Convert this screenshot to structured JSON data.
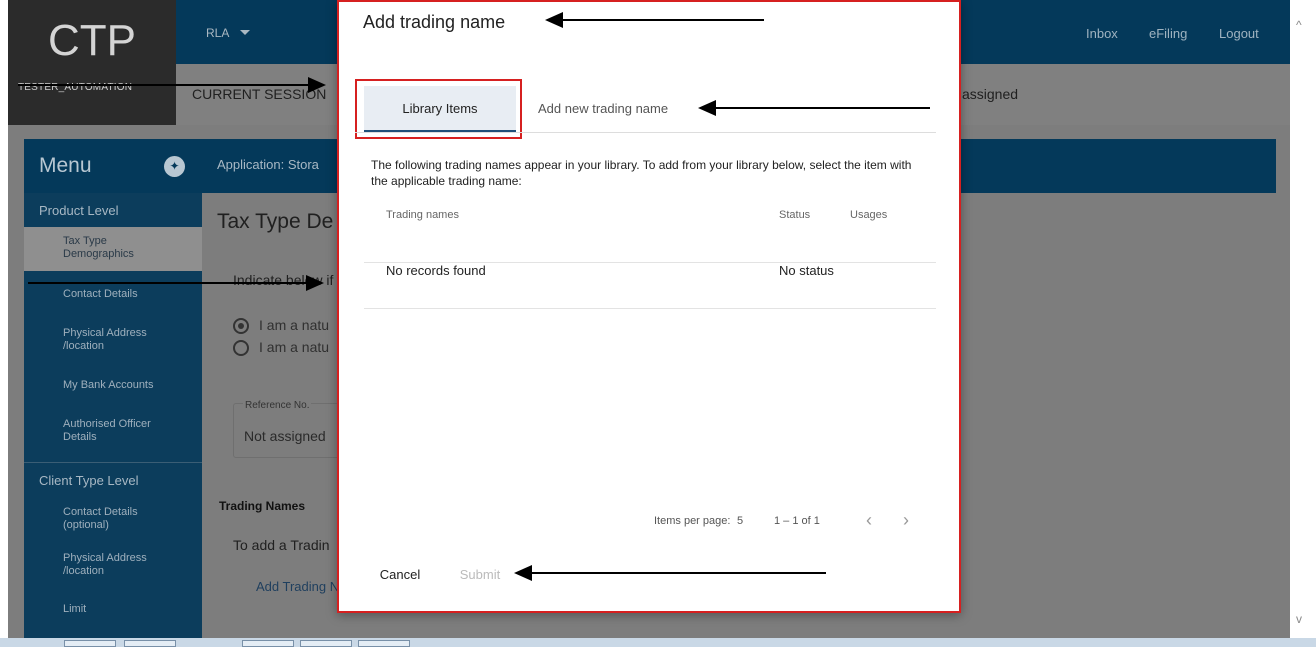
{
  "app": {
    "logo": "CTP",
    "user": "TESTER_AUTOMATION",
    "role_menu": "RLA",
    "top_nav": [
      "Inbox",
      "eFiling",
      "Logout"
    ],
    "session_label": "CURRENT SESSION",
    "session_right": "assigned"
  },
  "menu": {
    "title": "Menu",
    "product_level": "Product Level",
    "product_items": [
      "Tax Type Demographics",
      "Contact Details",
      "Physical Address /location",
      "My Bank Accounts",
      "Authorised Officer Details"
    ],
    "client_level": "Client Type Level",
    "client_items": [
      "Contact Details (optional)",
      "Physical Address /location",
      "Limit"
    ]
  },
  "page": {
    "app_title": "Application: Stora",
    "heading": "Tax Type De",
    "indicate": "Indicate below if",
    "radio_1": "I am a natu",
    "radio_2": "I am a natu",
    "ref_label": "Reference No.",
    "ref_value": "Not assigned",
    "trading_names": "Trading Names",
    "trading_add": "To add a Tradin",
    "trading_link": "Add Trading N"
  },
  "dialog": {
    "title": "Add trading name",
    "tabs": [
      "Library Items",
      "Add new trading name"
    ],
    "description": "The following trading names appear in your library. To add from your library below, select the item with the applicable trading name:",
    "columns": [
      "Trading names",
      "Status",
      "Usages"
    ],
    "rows": [
      [
        "No records found",
        "No status",
        ""
      ]
    ],
    "pager": {
      "items_per_page_label": "Items per page:",
      "items_per_page": "5",
      "range": "1 – 1 of 1",
      "prev": "‹",
      "next": "›"
    },
    "cancel": "Cancel",
    "submit": "Submit"
  },
  "colors": {
    "navy": "#04395a",
    "highlight_red": "#d62020",
    "overlay_gray": "#7d7d7d"
  }
}
